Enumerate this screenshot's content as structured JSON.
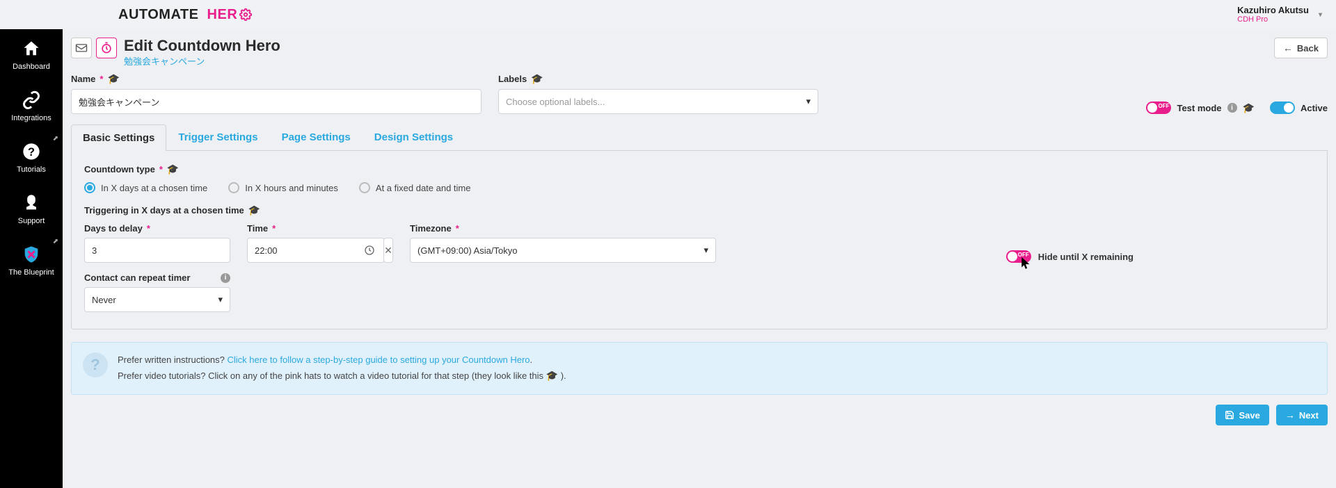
{
  "header": {
    "logo_a": "AUTOMATE",
    "logo_b": "HER",
    "user_name": "Kazuhiro Akutsu",
    "user_plan": "CDH Pro"
  },
  "sidebar": {
    "items": [
      {
        "label": "Dashboard"
      },
      {
        "label": "Integrations"
      },
      {
        "label": "Tutorials"
      },
      {
        "label": "Support"
      },
      {
        "label": "The Blueprint"
      }
    ]
  },
  "page": {
    "title": "Edit Countdown Hero",
    "subtitle": "勉強会キャンペーン",
    "back": "Back"
  },
  "form": {
    "name_label": "Name",
    "name_value": "勉強会キャンペーン",
    "labels_label": "Labels",
    "labels_placeholder": "Choose optional labels...",
    "test_mode": "Test mode",
    "test_mode_badge": "OFF",
    "active": "Active"
  },
  "tabs": [
    "Basic Settings",
    "Trigger Settings",
    "Page Settings",
    "Design Settings"
  ],
  "basic": {
    "countdown_type_label": "Countdown type",
    "opt1": "In X days at a chosen time",
    "opt2": "In X hours and minutes",
    "opt3": "At a fixed date and time",
    "triggering_label": "Triggering in X days at a chosen time",
    "days_label": "Days to delay",
    "days_value": "3",
    "time_label": "Time",
    "time_value": "22:00",
    "tz_label": "Timezone",
    "tz_value": "(GMT+09:00) Asia/Tokyo",
    "hide_label": "Hide until X remaining",
    "hide_badge": "OFF",
    "repeat_label": "Contact can repeat timer",
    "repeat_value": "Never"
  },
  "help": {
    "line1a": "Prefer written instructions? ",
    "line1link": "Click here to follow a step-by-step guide to setting up your Countdown Hero",
    "line1b": ".",
    "line2": "Prefer video tutorials? Click on any of the pink hats to watch a video tutorial for that step (they look like this ",
    "line2b": ")."
  },
  "footer": {
    "save": "Save",
    "next": "Next"
  }
}
